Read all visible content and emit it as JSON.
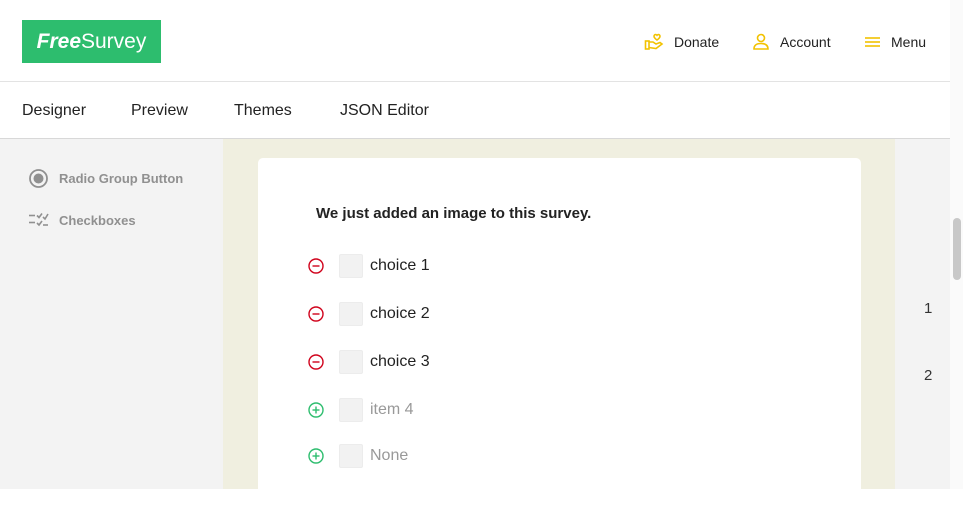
{
  "header": {
    "logo_free": "Free",
    "logo_survey": "Survey",
    "nav": [
      {
        "label": "Donate",
        "icon": "donate-hand-heart-icon"
      },
      {
        "label": "Account",
        "icon": "account-user-icon"
      },
      {
        "label": "Menu",
        "icon": "hamburger-menu-icon"
      }
    ],
    "accent_color": "#2dbd6e",
    "icon_color": "#f2c200"
  },
  "tabs": [
    {
      "label": "Designer"
    },
    {
      "label": "Preview"
    },
    {
      "label": "Themes"
    },
    {
      "label": "JSON Editor"
    }
  ],
  "toolbox": {
    "items": [
      {
        "label": "Radio Group Button",
        "icon": "radio-button-icon"
      },
      {
        "label": "Checkboxes",
        "icon": "checkboxes-icon"
      }
    ]
  },
  "question": {
    "title": "We just added an image to this survey.",
    "choices": [
      {
        "label": "choice 1",
        "action": "remove"
      },
      {
        "label": "choice 2",
        "action": "remove"
      },
      {
        "label": "choice 3",
        "action": "remove"
      },
      {
        "label": "item 4",
        "action": "add"
      },
      {
        "label": "None",
        "action": "add"
      }
    ],
    "remove_color": "#d0021b",
    "add_color": "#2dbd6e"
  },
  "pages": {
    "numbers": [
      "1",
      "2"
    ]
  }
}
